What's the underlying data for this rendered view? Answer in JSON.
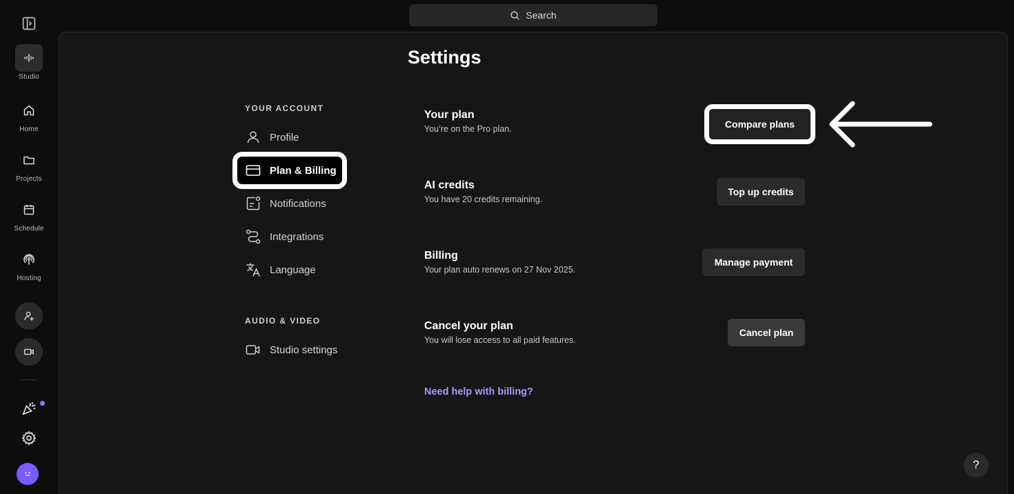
{
  "search": {
    "label": "Search"
  },
  "rail": {
    "items": [
      {
        "label": "Studio",
        "icon": "waveform-icon"
      },
      {
        "label": "Home",
        "icon": "home-icon"
      },
      {
        "label": "Projects",
        "icon": "folder-icon"
      },
      {
        "label": "Schedule",
        "icon": "calendar-icon"
      },
      {
        "label": "Hosting",
        "icon": "podcast-icon"
      }
    ]
  },
  "page": {
    "title": "Settings"
  },
  "nav": {
    "account_header": "YOUR ACCOUNT",
    "account_items": [
      {
        "label": "Profile",
        "icon": "user-icon"
      },
      {
        "label": "Plan & Billing",
        "icon": "credit-card-icon",
        "active": true
      },
      {
        "label": "Notifications",
        "icon": "notification-icon"
      },
      {
        "label": "Integrations",
        "icon": "integrations-icon"
      },
      {
        "label": "Language",
        "icon": "translate-icon"
      }
    ],
    "av_header": "AUDIO & VIDEO",
    "av_items": [
      {
        "label": "Studio settings",
        "icon": "video-camera-icon"
      }
    ]
  },
  "rows": [
    {
      "title": "Your plan",
      "subtitle": "You’re on the Pro plan.",
      "button": "Compare plans"
    },
    {
      "title": "AI credits",
      "subtitle": "You have 20 credits remaining.",
      "button": "Top up credits"
    },
    {
      "title": "Billing",
      "subtitle": "Your plan auto renews on 27 Nov 2025.",
      "button": "Manage payment"
    },
    {
      "title": "Cancel your plan",
      "subtitle": "You will lose access to all paid features.",
      "button": "Cancel plan"
    }
  ],
  "help_link": "Need help with billing?",
  "help_fab": "?",
  "colors": {
    "accent": "#a997ff",
    "background": "#0d0d0d",
    "panel": "#161616"
  }
}
